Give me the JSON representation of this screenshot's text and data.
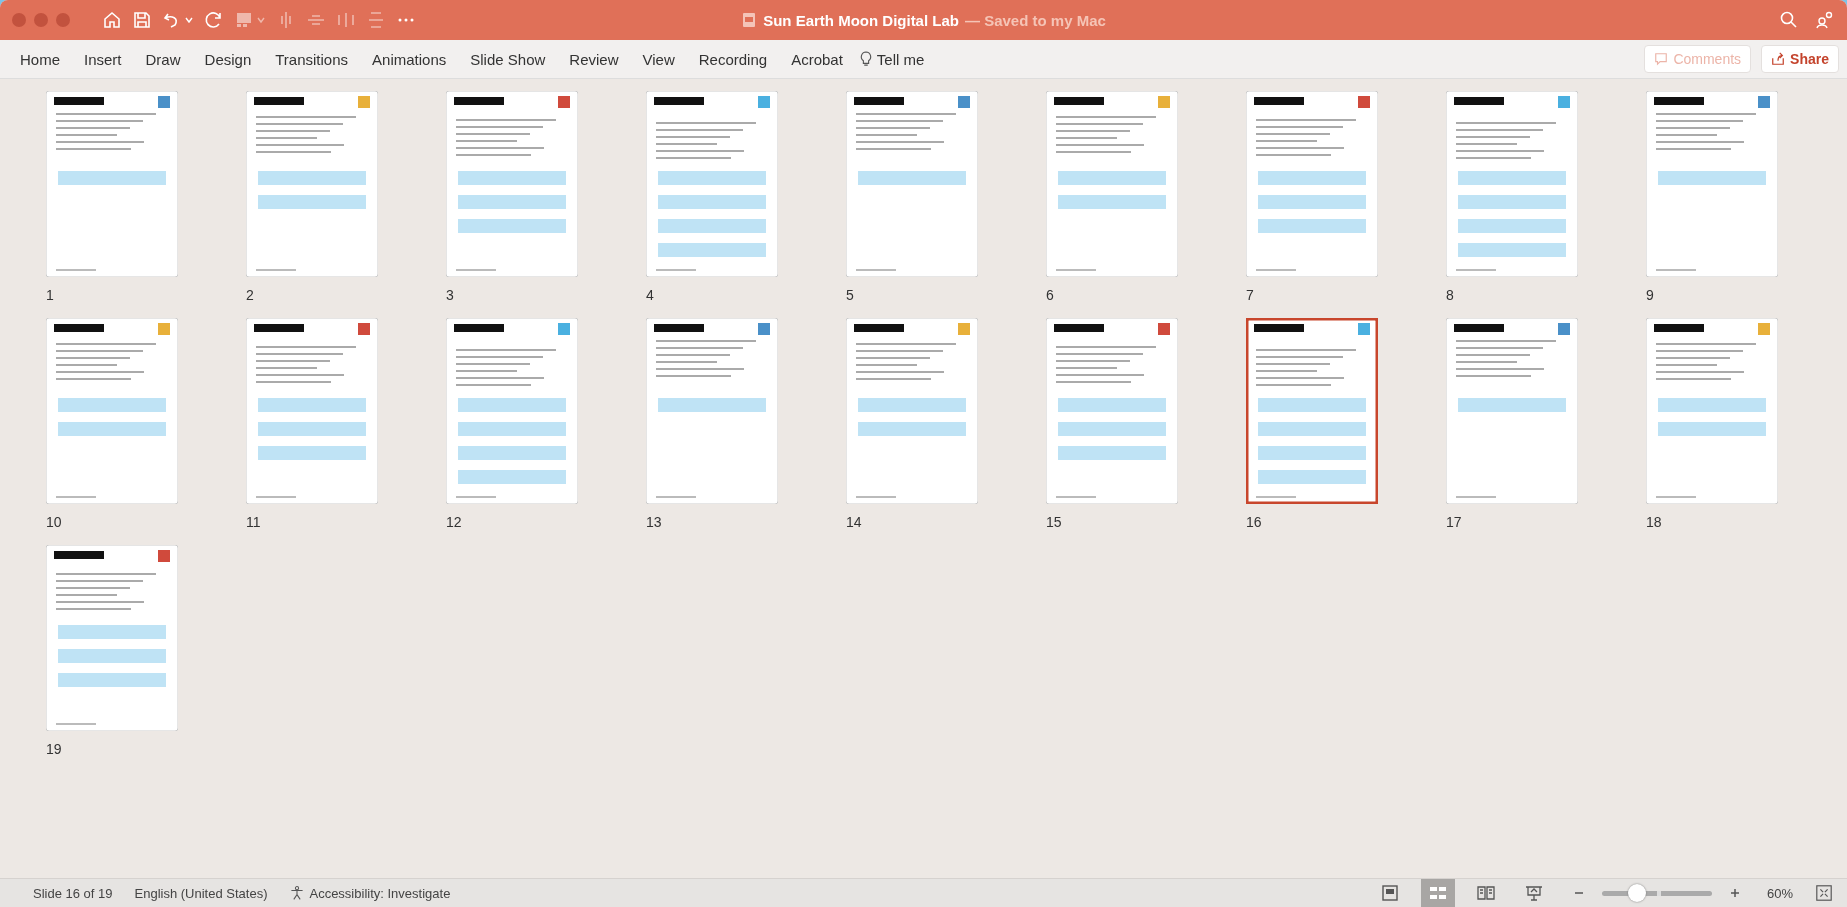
{
  "window": {
    "title": "Sun Earth Moon Digital Lab",
    "subtitle": "— Saved to my Mac"
  },
  "ribbon_tabs": [
    {
      "label": "Home",
      "selected": false
    },
    {
      "label": "Insert",
      "selected": false
    },
    {
      "label": "Draw",
      "selected": false
    },
    {
      "label": "Design",
      "selected": false
    },
    {
      "label": "Transitions",
      "selected": false
    },
    {
      "label": "Animations",
      "selected": false
    },
    {
      "label": "Slide Show",
      "selected": false
    },
    {
      "label": "Review",
      "selected": false
    },
    {
      "label": "View",
      "selected": false
    },
    {
      "label": "Recording",
      "selected": false
    },
    {
      "label": "Acrobat",
      "selected": false
    }
  ],
  "tell_me": "Tell me",
  "comments_button": {
    "label": "Comments",
    "disabled": true
  },
  "share_button": {
    "label": "Share",
    "disabled": false
  },
  "slides": [
    {
      "number": "1",
      "selected": false
    },
    {
      "number": "2",
      "selected": false
    },
    {
      "number": "3",
      "selected": false
    },
    {
      "number": "4",
      "selected": false
    },
    {
      "number": "5",
      "selected": false
    },
    {
      "number": "6",
      "selected": false
    },
    {
      "number": "7",
      "selected": false
    },
    {
      "number": "8",
      "selected": false
    },
    {
      "number": "9",
      "selected": false
    },
    {
      "number": "10",
      "selected": false
    },
    {
      "number": "11",
      "selected": false
    },
    {
      "number": "12",
      "selected": false
    },
    {
      "number": "13",
      "selected": false
    },
    {
      "number": "14",
      "selected": false
    },
    {
      "number": "15",
      "selected": false
    },
    {
      "number": "16",
      "selected": true
    },
    {
      "number": "17",
      "selected": false
    },
    {
      "number": "18",
      "selected": false
    },
    {
      "number": "19",
      "selected": false
    }
  ],
  "status_bar": {
    "slide_info": "Slide 16 of 19",
    "language": "English (United States)",
    "accessibility": "Accessibility: Investigate",
    "views": [
      {
        "kind": "normal",
        "selected": false
      },
      {
        "kind": "sorter",
        "selected": true
      },
      {
        "kind": "reading",
        "selected": false
      },
      {
        "kind": "slideshow",
        "selected": false
      }
    ],
    "zoom": {
      "level": 0.3,
      "reading": "60%"
    }
  }
}
